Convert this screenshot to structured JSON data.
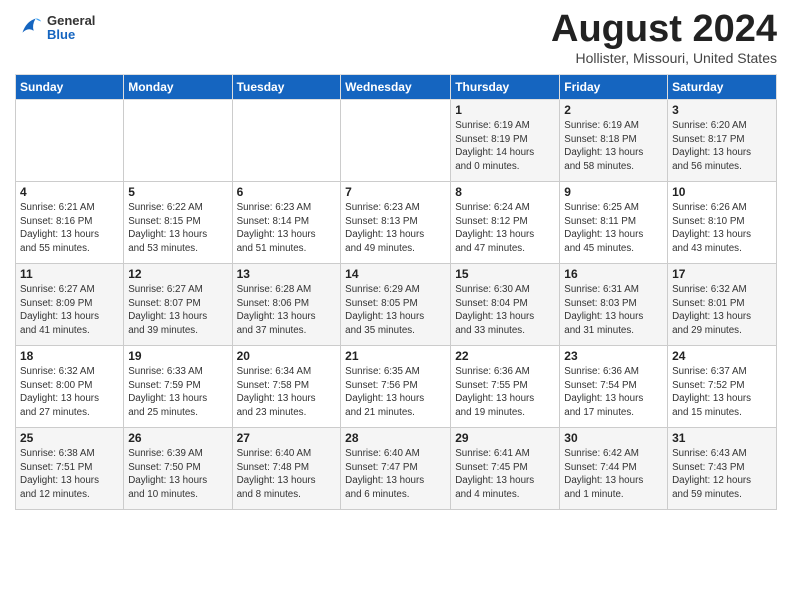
{
  "header": {
    "logo": {
      "general": "General",
      "blue": "Blue"
    },
    "title": "August 2024",
    "location": "Hollister, Missouri, United States"
  },
  "days_header": [
    "Sunday",
    "Monday",
    "Tuesday",
    "Wednesday",
    "Thursday",
    "Friday",
    "Saturday"
  ],
  "weeks": [
    [
      {
        "day": "",
        "info": ""
      },
      {
        "day": "",
        "info": ""
      },
      {
        "day": "",
        "info": ""
      },
      {
        "day": "",
        "info": ""
      },
      {
        "day": "1",
        "info": "Sunrise: 6:19 AM\nSunset: 8:19 PM\nDaylight: 14 hours\nand 0 minutes."
      },
      {
        "day": "2",
        "info": "Sunrise: 6:19 AM\nSunset: 8:18 PM\nDaylight: 13 hours\nand 58 minutes."
      },
      {
        "day": "3",
        "info": "Sunrise: 6:20 AM\nSunset: 8:17 PM\nDaylight: 13 hours\nand 56 minutes."
      }
    ],
    [
      {
        "day": "4",
        "info": "Sunrise: 6:21 AM\nSunset: 8:16 PM\nDaylight: 13 hours\nand 55 minutes."
      },
      {
        "day": "5",
        "info": "Sunrise: 6:22 AM\nSunset: 8:15 PM\nDaylight: 13 hours\nand 53 minutes."
      },
      {
        "day": "6",
        "info": "Sunrise: 6:23 AM\nSunset: 8:14 PM\nDaylight: 13 hours\nand 51 minutes."
      },
      {
        "day": "7",
        "info": "Sunrise: 6:23 AM\nSunset: 8:13 PM\nDaylight: 13 hours\nand 49 minutes."
      },
      {
        "day": "8",
        "info": "Sunrise: 6:24 AM\nSunset: 8:12 PM\nDaylight: 13 hours\nand 47 minutes."
      },
      {
        "day": "9",
        "info": "Sunrise: 6:25 AM\nSunset: 8:11 PM\nDaylight: 13 hours\nand 45 minutes."
      },
      {
        "day": "10",
        "info": "Sunrise: 6:26 AM\nSunset: 8:10 PM\nDaylight: 13 hours\nand 43 minutes."
      }
    ],
    [
      {
        "day": "11",
        "info": "Sunrise: 6:27 AM\nSunset: 8:09 PM\nDaylight: 13 hours\nand 41 minutes."
      },
      {
        "day": "12",
        "info": "Sunrise: 6:27 AM\nSunset: 8:07 PM\nDaylight: 13 hours\nand 39 minutes."
      },
      {
        "day": "13",
        "info": "Sunrise: 6:28 AM\nSunset: 8:06 PM\nDaylight: 13 hours\nand 37 minutes."
      },
      {
        "day": "14",
        "info": "Sunrise: 6:29 AM\nSunset: 8:05 PM\nDaylight: 13 hours\nand 35 minutes."
      },
      {
        "day": "15",
        "info": "Sunrise: 6:30 AM\nSunset: 8:04 PM\nDaylight: 13 hours\nand 33 minutes."
      },
      {
        "day": "16",
        "info": "Sunrise: 6:31 AM\nSunset: 8:03 PM\nDaylight: 13 hours\nand 31 minutes."
      },
      {
        "day": "17",
        "info": "Sunrise: 6:32 AM\nSunset: 8:01 PM\nDaylight: 13 hours\nand 29 minutes."
      }
    ],
    [
      {
        "day": "18",
        "info": "Sunrise: 6:32 AM\nSunset: 8:00 PM\nDaylight: 13 hours\nand 27 minutes."
      },
      {
        "day": "19",
        "info": "Sunrise: 6:33 AM\nSunset: 7:59 PM\nDaylight: 13 hours\nand 25 minutes."
      },
      {
        "day": "20",
        "info": "Sunrise: 6:34 AM\nSunset: 7:58 PM\nDaylight: 13 hours\nand 23 minutes."
      },
      {
        "day": "21",
        "info": "Sunrise: 6:35 AM\nSunset: 7:56 PM\nDaylight: 13 hours\nand 21 minutes."
      },
      {
        "day": "22",
        "info": "Sunrise: 6:36 AM\nSunset: 7:55 PM\nDaylight: 13 hours\nand 19 minutes."
      },
      {
        "day": "23",
        "info": "Sunrise: 6:36 AM\nSunset: 7:54 PM\nDaylight: 13 hours\nand 17 minutes."
      },
      {
        "day": "24",
        "info": "Sunrise: 6:37 AM\nSunset: 7:52 PM\nDaylight: 13 hours\nand 15 minutes."
      }
    ],
    [
      {
        "day": "25",
        "info": "Sunrise: 6:38 AM\nSunset: 7:51 PM\nDaylight: 13 hours\nand 12 minutes."
      },
      {
        "day": "26",
        "info": "Sunrise: 6:39 AM\nSunset: 7:50 PM\nDaylight: 13 hours\nand 10 minutes."
      },
      {
        "day": "27",
        "info": "Sunrise: 6:40 AM\nSunset: 7:48 PM\nDaylight: 13 hours\nand 8 minutes."
      },
      {
        "day": "28",
        "info": "Sunrise: 6:40 AM\nSunset: 7:47 PM\nDaylight: 13 hours\nand 6 minutes."
      },
      {
        "day": "29",
        "info": "Sunrise: 6:41 AM\nSunset: 7:45 PM\nDaylight: 13 hours\nand 4 minutes."
      },
      {
        "day": "30",
        "info": "Sunrise: 6:42 AM\nSunset: 7:44 PM\nDaylight: 13 hours\nand 1 minute."
      },
      {
        "day": "31",
        "info": "Sunrise: 6:43 AM\nSunset: 7:43 PM\nDaylight: 12 hours\nand 59 minutes."
      }
    ]
  ]
}
